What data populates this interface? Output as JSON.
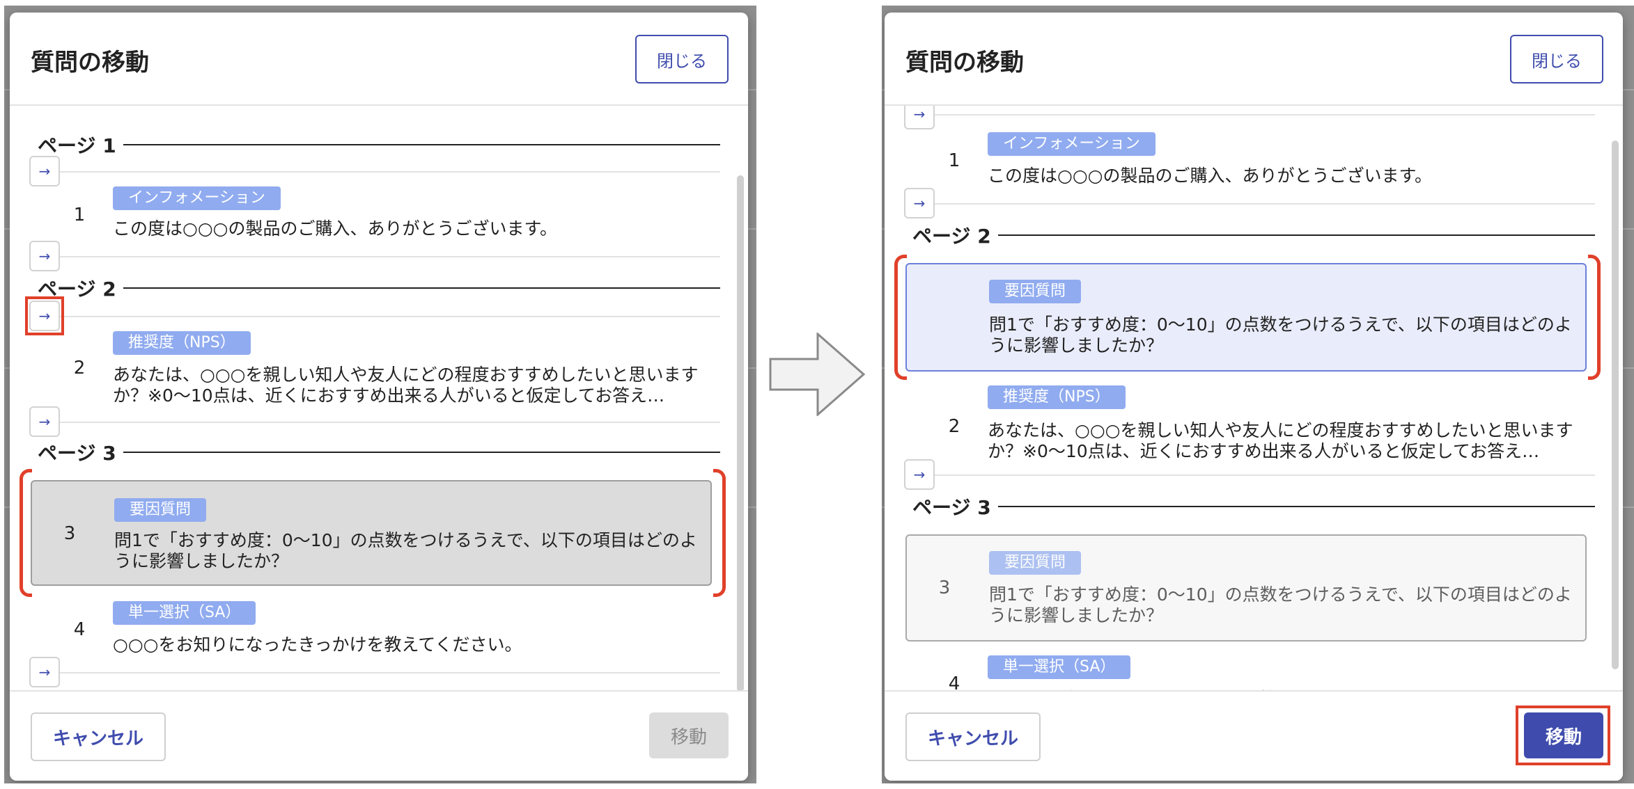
{
  "dialog": {
    "title": "質問の移動",
    "close_label": "閉じる",
    "cancel_label": "キャンセル",
    "move_label": "移動",
    "arrow_glyph": "→"
  },
  "pages": {
    "page1": "ページ 1",
    "page2": "ページ 2",
    "page3": "ページ 3"
  },
  "questions": [
    {
      "number": "1",
      "type": "インフォメーション",
      "text": "この度は○○○の製品のご購入、ありがとうございます。"
    },
    {
      "number": "2",
      "type": "推奨度（NPS）",
      "text": "あなたは、○○○を親しい知人や友人にどの程度おすすめしたいと思いますか？※0〜10点は、近くにおすすめ出来る人がいると仮定してお答え…"
    },
    {
      "number": "3",
      "type": "要因質問",
      "text": "問1で「おすすめ度：0〜10」の点数をつけるうえで、以下の項目はどのように影響しましたか？"
    },
    {
      "number": "4",
      "type": "単一選択（SA）",
      "text": "○○○をお知りになったきっかけを教えてください。"
    }
  ],
  "colors": {
    "accent": "#3f4cad",
    "tag": "#90abef",
    "highlight": "#e0402a",
    "selected_card": "#dcdcdc",
    "moved_card": "#e9ecfa"
  },
  "icons": {
    "move_here": "arrow-right-icon",
    "transition": "big-right-arrow-icon"
  }
}
